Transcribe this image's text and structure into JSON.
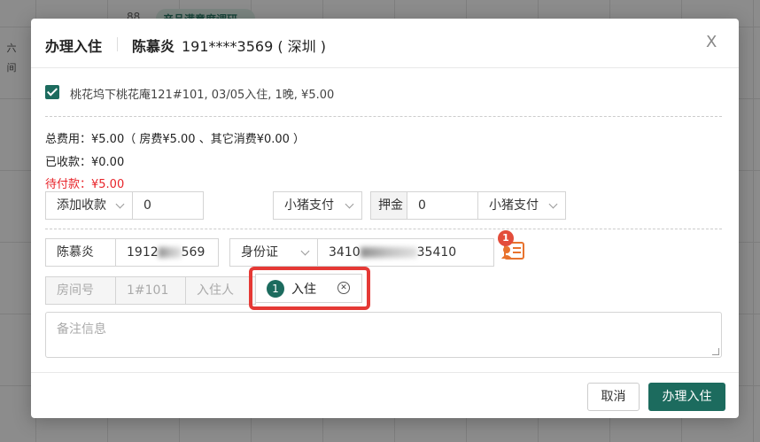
{
  "background": {
    "side_labels": [
      "六",
      "间"
    ],
    "tab_label": "产品满意度调研",
    "grid_icon": "grid-icon"
  },
  "dialog": {
    "title": "办理入住",
    "guest_name": "陈慕炎",
    "guest_info": "191****3569 ( 深圳 )",
    "close_label": "X",
    "room_line": "桃花坞下桃花庵121#101, 03/05入住, 1晚, ¥5.00",
    "fees": {
      "total": "总费用：¥5.00（ 房费¥5.00 、其它消费¥0.00 ）",
      "received": "已收款：¥0.00",
      "due": "待付款：¥5.00"
    },
    "payment": {
      "add_label": "添加收款",
      "add_amount": "0",
      "method1": "小猪支付",
      "deposit_label": "押金",
      "deposit_amount": "0",
      "method2": "小猪支付"
    },
    "guest_row": {
      "name": "陈慕炎",
      "phone_start": "1912",
      "phone_end": "569",
      "id_type": "身份证",
      "id_start": "3410",
      "id_end": "35410",
      "badge": "1"
    },
    "room_row": {
      "room_no_label": "房间号",
      "room_no": "1#101",
      "occupant_label": "入住人",
      "tag_number": "1",
      "tag_label": "入住"
    },
    "remark_placeholder": "备注信息",
    "buttons": {
      "cancel": "取消",
      "ok": "办理入住"
    }
  }
}
